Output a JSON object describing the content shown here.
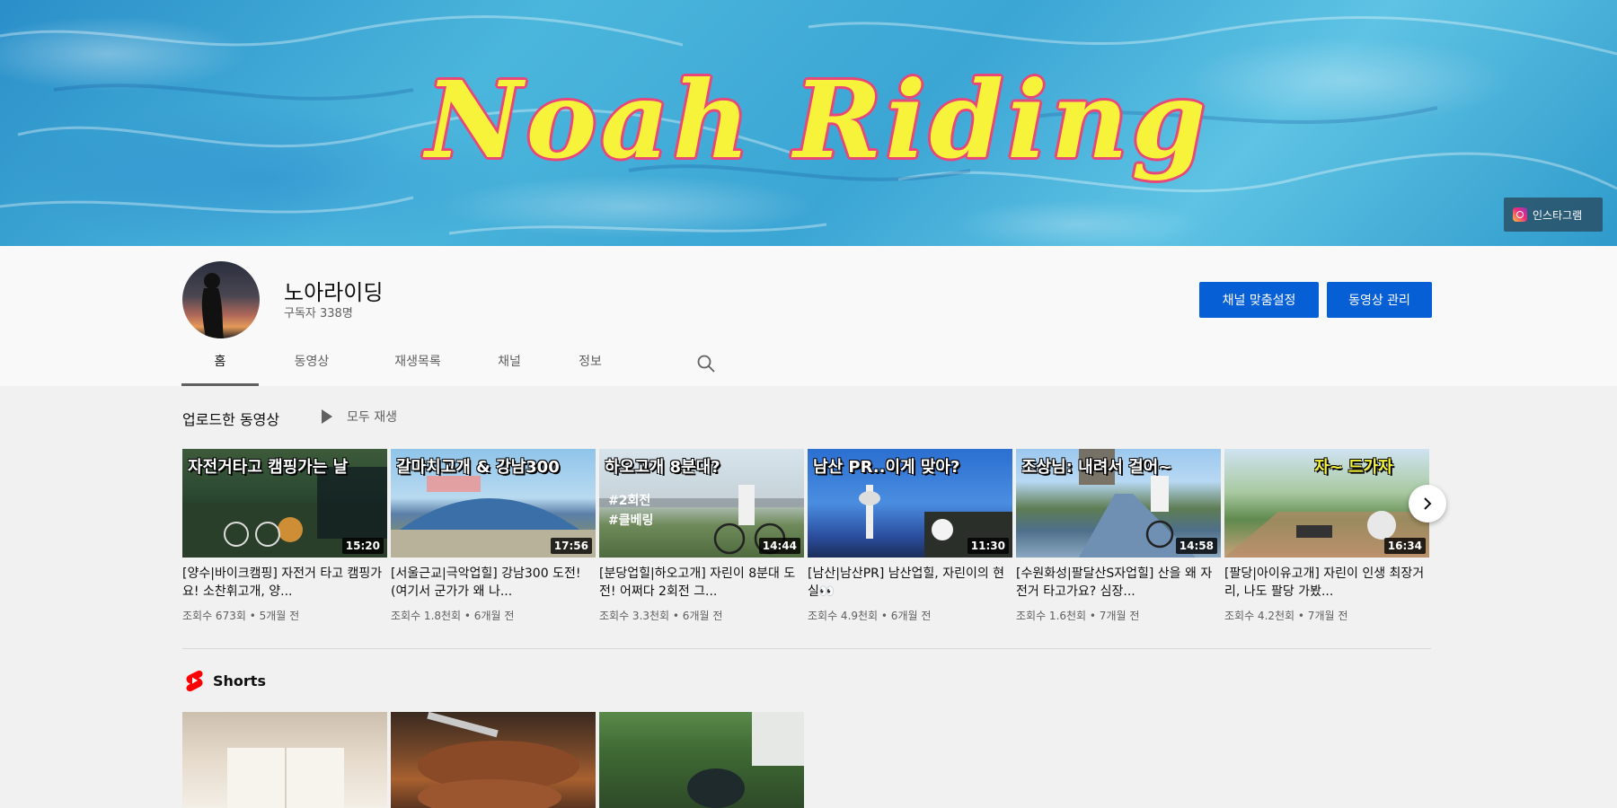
{
  "banner": {
    "title": "Noah Riding",
    "link_label": "인스타그램",
    "link_icon": "instagram-icon"
  },
  "channel": {
    "name": "노아라이딩",
    "subscribers": "구독자 338명",
    "customize_label": "채널 맞춤설정",
    "manage_label": "동영상 관리",
    "accent": "#065fd4"
  },
  "tabs": [
    {
      "label": "홈",
      "active": true
    },
    {
      "label": "동영상"
    },
    {
      "label": "재생목록"
    },
    {
      "label": "채널"
    },
    {
      "label": "정보"
    }
  ],
  "uploads": {
    "title": "업로드한 동영상",
    "play_all": "모두 재생",
    "videos": [
      {
        "thumb_text": "자전거타고 캠핑가는 날",
        "duration": "15:20",
        "title": "[양수|바이크캠핑] 자전거 타고 캠핑가요! 소찬휘고개, 양...",
        "meta": "조회수 673회 • 5개월 전"
      },
      {
        "thumb_text": "갈마치고개 & 강남300",
        "duration": "17:56",
        "title": "[서울근교|극악업힐] 강남300 도전! (여기서 군가가 왜 나...",
        "meta": "조회수 1.8천회 • 6개월 전"
      },
      {
        "thumb_text": "하오고개 8분대?",
        "duration": "14:44",
        "title": "[분당업힐|하오고개] 자린이 8분대 도전! 어쩌다 2회전 그...",
        "meta": "조회수 3.3천회 • 6개월 전"
      },
      {
        "thumb_text": "남산 PR..이게 맞아?",
        "duration": "11:30",
        "title": "[남산|남산PR] 남산업힐, 자린이의 현실👀",
        "meta": "조회수 4.9천회 • 6개월 전"
      },
      {
        "thumb_text": "조상님: 내려서 걸어~",
        "duration": "14:58",
        "title": "[수원화성|팔달산S자업힐] 산을 왜 자전거 타고가요? 심장...",
        "meta": "조회수 1.6천회 • 7개월 전"
      },
      {
        "thumb_text": "자~ 드가자",
        "duration": "16:34",
        "title": "[팔당|아이유고개] 자린이 인생 최장거리, 나도 팔당 가봤...",
        "meta": "조회수 4.2천회 • 7개월 전"
      }
    ]
  },
  "shorts": {
    "title": "Shorts"
  }
}
